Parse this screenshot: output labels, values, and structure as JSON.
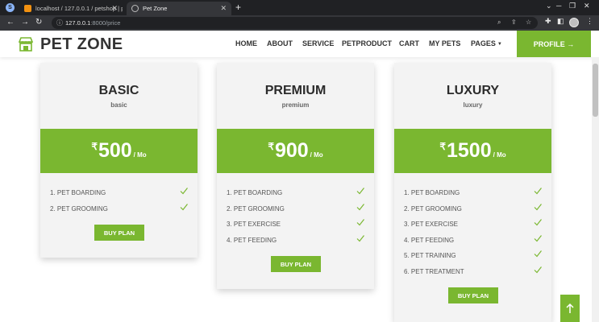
{
  "browser": {
    "tabs": [
      {
        "title": "localhost / 127.0.0.1 / petshop | p"
      },
      {
        "title": "Pet Zone"
      }
    ],
    "url_host": "127.0.0.1",
    "url_path": ":8000/price",
    "new_tab_symbol": "+",
    "icons": [
      "back-icon",
      "forward-icon",
      "reload-icon",
      "search-icon",
      "share-icon",
      "star-icon",
      "extensions-icon",
      "sidebar-icon",
      "profile-icon",
      "menu-icon"
    ]
  },
  "site": {
    "brand": "PET ZONE",
    "menu": [
      "HOME",
      "ABOUT",
      "SERVICE",
      "PETPRODUCT",
      "CART",
      "MY PETS",
      "PAGES"
    ],
    "profile_button": "PROFILE →",
    "accent_color": "#7ab730"
  },
  "plans": [
    {
      "title": "BASIC",
      "subtitle": "basic",
      "currency": "₹",
      "price": "500",
      "period": "/ Mo",
      "features": [
        "1. PET BOARDING",
        "2. PET GROOMING"
      ],
      "button": "BUY PLAN"
    },
    {
      "title": "PREMIUM",
      "subtitle": "premium",
      "currency": "₹",
      "price": "900",
      "period": "/ Mo",
      "features": [
        "1. PET BOARDING",
        "2. PET GROOMING",
        "3. PET EXERCISE",
        "4. PET FEEDING"
      ],
      "button": "BUY PLAN"
    },
    {
      "title": "LUXURY",
      "subtitle": "luxury",
      "currency": "₹",
      "price": "1500",
      "period": "/ Mo",
      "features": [
        "1. PET BOARDING",
        "2. PET GROOMING",
        "3. PET EXERCISE",
        "4. PET FEEDING",
        "5. PET TRAINING",
        "6. PET TREATMENT"
      ],
      "button": "BUY PLAN"
    }
  ]
}
